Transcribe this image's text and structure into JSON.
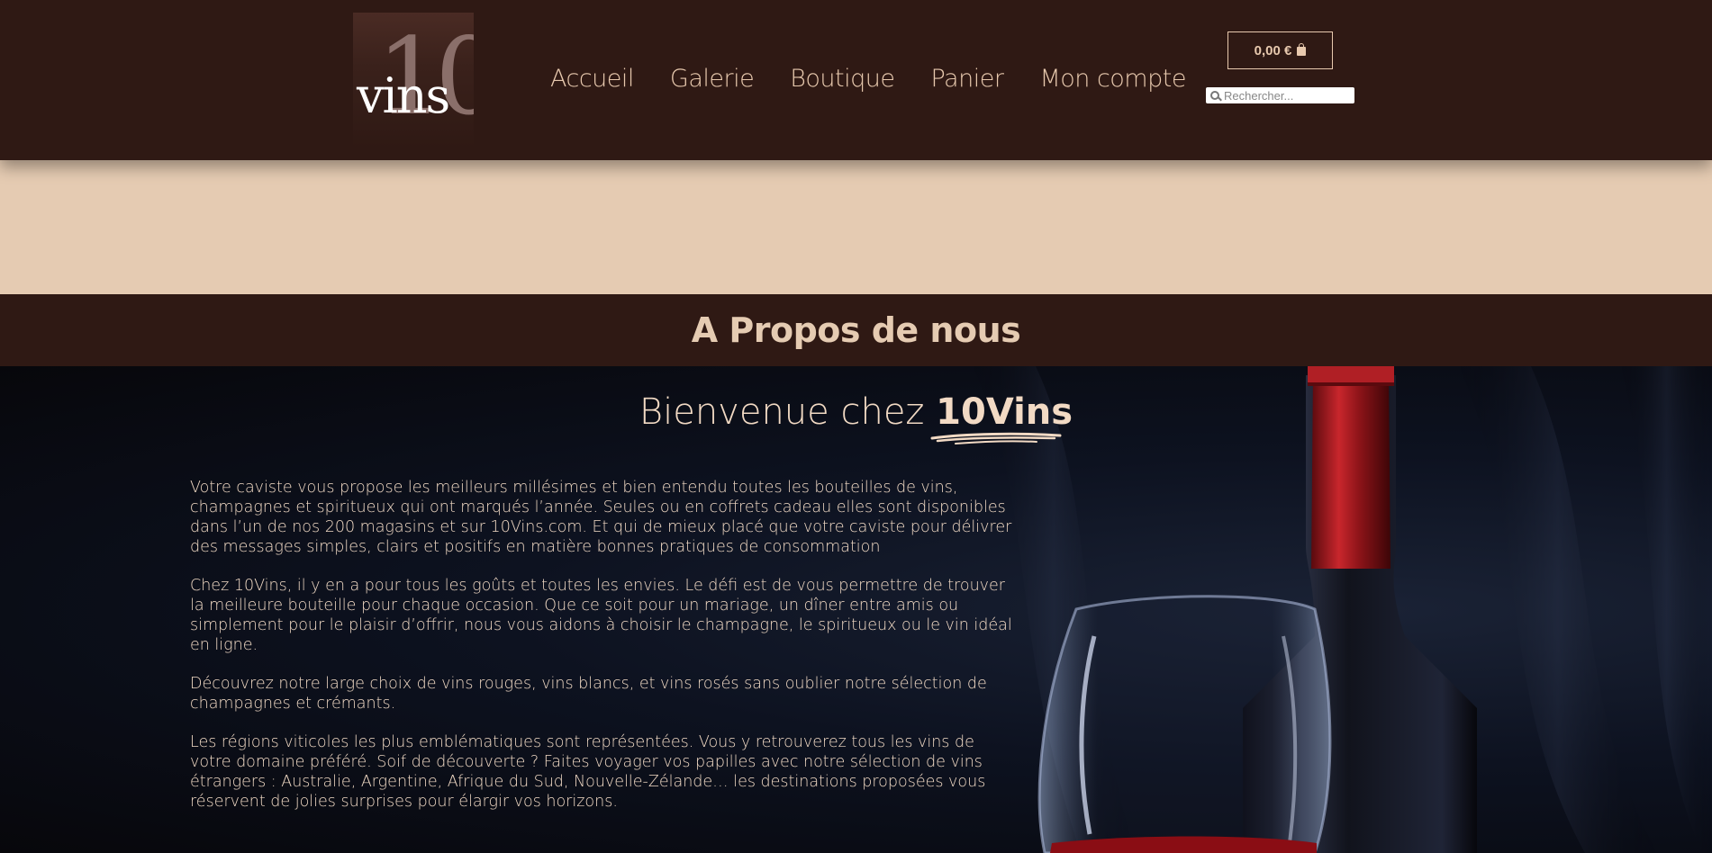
{
  "header": {
    "logo": {
      "number": "10",
      "word": "vins"
    },
    "nav": [
      "Accueil",
      "Galerie",
      "Boutique",
      "Panier",
      "Mon compte"
    ],
    "cart": {
      "total": "0,00 €",
      "icon": "shopping-bag-icon"
    },
    "search": {
      "placeholder": "Rechercher...",
      "icon": "search-icon"
    }
  },
  "colors": {
    "header_bg": "#2f1914",
    "accent": "#e5cbb2",
    "text_light": "#f0d9c4"
  },
  "section": {
    "title": "A Propos de nous"
  },
  "hero": {
    "welcome_prefix": "Bienvenue chez",
    "welcome_brand": "10Vins",
    "paragraphs": [
      "Votre caviste vous propose les meilleurs millésimes et bien entendu toutes les bouteilles de vins, champagnes et spiritueux qui ont marqués l’année. Seules ou en coffrets cadeau elles sont disponibles dans l’un de nos 200 magasins et sur 10Vins.com. Et qui de mieux placé que votre caviste pour délivrer des messages simples, clairs et positifs en matière bonnes pratiques de consommation",
      "Chez 10Vins, il y en a pour tous les goûts et toutes les envies. Le défi est de vous permettre de trouver la meilleure bouteille pour chaque occasion. Que ce soit pour un mariage, un dîner entre amis ou simplement pour le plaisir d’offrir, nous vous aidons à choisir le champagne, le spiritueux ou le vin idéal en ligne.",
      "Découvrez notre large choix de vins rouges, vins blancs, et vins rosés sans oublier notre sélection de champagnes et crémants.",
      "Les régions viticoles les plus emblématiques sont représentées. Vous y retrouverez tous les vins de votre domaine préféré. Soif de découverte ? Faites voyager vos papilles avec notre sélection de vins étrangers : Australie, Argentine, Afrique du Sud, Nouvelle-Zélande… les destinations proposées vous réservent de jolies surprises pour élargir vos horizons."
    ]
  }
}
